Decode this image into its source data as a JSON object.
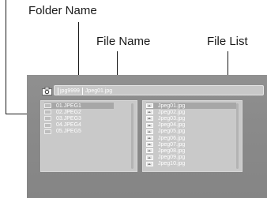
{
  "callouts": {
    "folder_name": "Folder Name",
    "file_name": "File Name",
    "file_list": "File List"
  },
  "path_bar": {
    "folder": "jpg9999",
    "file": "Jpeg01.jpg"
  },
  "folders": {
    "items": [
      {
        "label": "01.JPEG1",
        "icon": "folder-icon",
        "selected": true
      },
      {
        "label": "02.JPEG2",
        "icon": "folder-icon",
        "selected": false
      },
      {
        "label": "03.JPEG3",
        "icon": "folder-icon",
        "selected": false
      },
      {
        "label": "04.JPEG4",
        "icon": "folder-icon",
        "selected": false
      },
      {
        "label": "05.JPEG5",
        "icon": "folder-icon",
        "selected": false
      }
    ]
  },
  "files": {
    "items": [
      {
        "label": "Jpeg01.jpg",
        "icon": "image-icon",
        "selected": true
      },
      {
        "label": "Jpeg02.jpg",
        "icon": "image-icon",
        "selected": false
      },
      {
        "label": "Jpeg03.jpg",
        "icon": "image-icon",
        "selected": false
      },
      {
        "label": "Jpeg04.jpg",
        "icon": "image-icon",
        "selected": false
      },
      {
        "label": "Jpeg05.jpg",
        "icon": "image-icon",
        "selected": false
      },
      {
        "label": "Jpeg06.jpg",
        "icon": "image-icon",
        "selected": false
      },
      {
        "label": "Jpeg07.jpg",
        "icon": "image-icon",
        "selected": false
      },
      {
        "label": "Jpeg08.jpg",
        "icon": "image-icon",
        "selected": false
      },
      {
        "label": "Jpeg09.jpg",
        "icon": "image-icon",
        "selected": false
      },
      {
        "label": "Jpeg10.jpg",
        "icon": "image-icon",
        "selected": false
      }
    ]
  },
  "colors": {
    "screen": "#8c8c8c",
    "pane": "#c9c9c9",
    "selection": "#a7a7a7",
    "text": "#ffffff",
    "callout_text": "#1a1a1a"
  }
}
